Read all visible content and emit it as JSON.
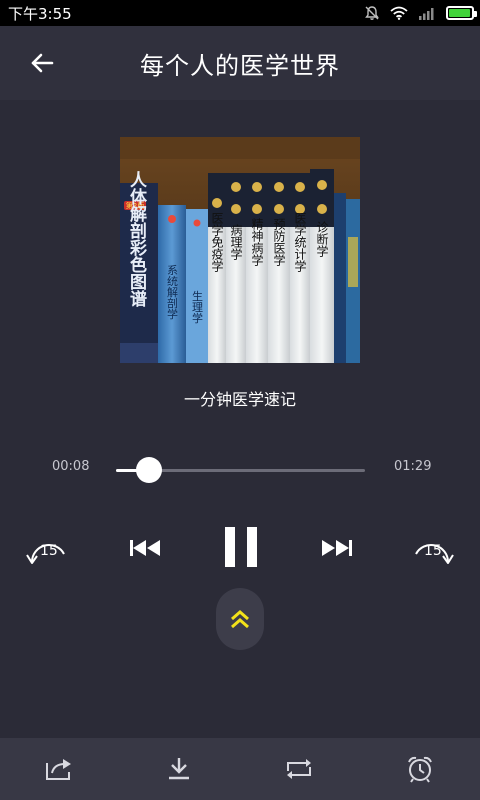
{
  "status_bar": {
    "time": "下午3:55",
    "battery_level": 0.95,
    "icons": [
      "mute-icon",
      "wifi-icon",
      "signal-icon",
      "battery-icon"
    ]
  },
  "header": {
    "title": "每个人的医学世界",
    "back_icon": "back-arrow-icon"
  },
  "album": {
    "cover_book_titles": [
      "人体解剖彩色图谱",
      "系统解剖学",
      "生理学",
      "医学免疫学",
      "病理学",
      "精神病学",
      "预防医学",
      "医学统计学",
      "诊断学"
    ],
    "cover_book_edition": "第2版"
  },
  "track": {
    "title": "一分钟医学速记"
  },
  "progress": {
    "current_time": "00:08",
    "total_time": "01:29",
    "fraction": 0.134
  },
  "controls": {
    "skip_back_seconds": "15",
    "skip_forward_seconds": "15"
  },
  "colors": {
    "background": "#2b2b37",
    "header": "#30303d",
    "toolbar": "#383845",
    "accent_expand": "#f3e21a",
    "battery": "#41d33a"
  }
}
